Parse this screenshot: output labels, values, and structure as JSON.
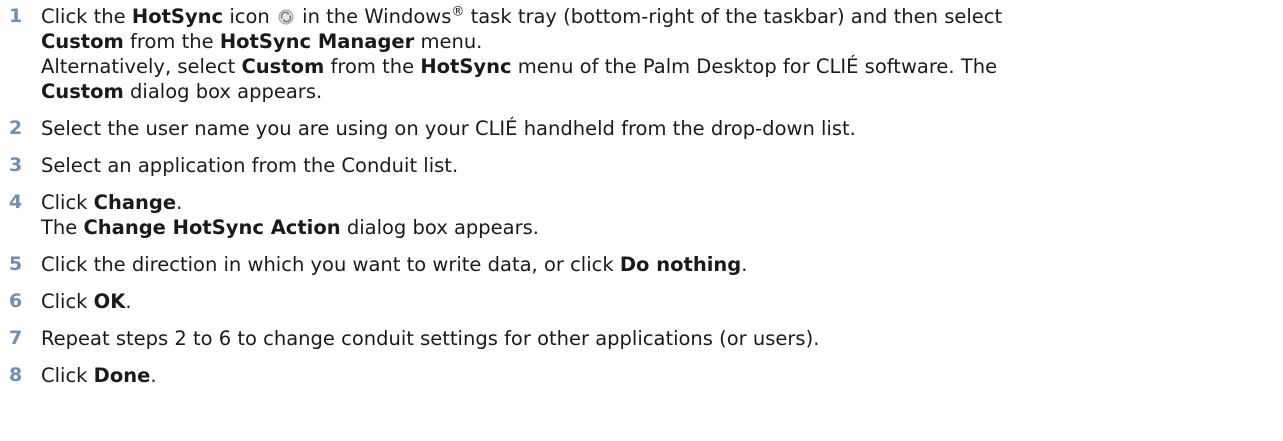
{
  "steps": [
    {
      "num": "1",
      "line1": {
        "t1": "Click the ",
        "b1": "HotSync",
        "t2": " icon ",
        "t3": " in the Windows",
        "sup": "®",
        "t4": " task tray (bottom-right of the taskbar) and then select"
      },
      "line2": {
        "b1": "Custom",
        "t1": " from the ",
        "b2": "HotSync Manager",
        "t2": " menu."
      },
      "line3": {
        "t1": "Alternatively, select ",
        "b1": "Custom",
        "t2": " from the ",
        "b2": "HotSync",
        "t3": " menu of the Palm Desktop for CLIÉ software. The"
      },
      "line4": {
        "b1": "Custom",
        "t1": " dialog box appears."
      }
    },
    {
      "num": "2",
      "text": "Select the user name you are using on your CLIÉ handheld from the drop-down list."
    },
    {
      "num": "3",
      "text": "Select an application from the Conduit list."
    },
    {
      "num": "4",
      "line1": {
        "t1": "Click ",
        "b1": "Change",
        "t2": "."
      },
      "line2": {
        "t1": "The ",
        "b1": "Change HotSync Action",
        "t2": " dialog box appears."
      }
    },
    {
      "num": "5",
      "t1": "Click the direction in which you want to write data, or click ",
      "b1": "Do nothing",
      "t2": "."
    },
    {
      "num": "6",
      "t1": "Click ",
      "b1": "OK",
      "t2": "."
    },
    {
      "num": "7",
      "text": "Repeat steps 2 to 6 to change conduit settings for other applications (or users)."
    },
    {
      "num": "8",
      "t1": "Click ",
      "b1": "Done",
      "t2": "."
    }
  ],
  "icons": {
    "hotsync": "hotsync-icon"
  }
}
